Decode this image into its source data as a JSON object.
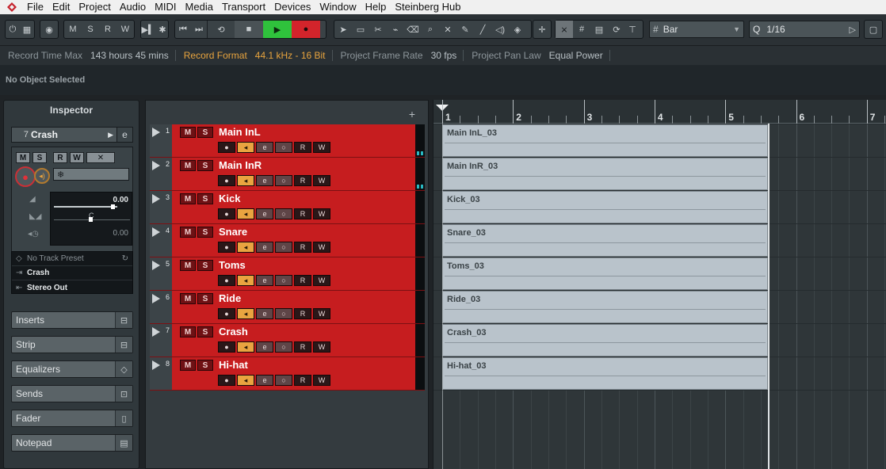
{
  "menu": {
    "logo_icon": "steinberg-logo-icon",
    "items": [
      "File",
      "Edit",
      "Project",
      "Audio",
      "MIDI",
      "Media",
      "Transport",
      "Devices",
      "Window",
      "Help",
      "Steinberg Hub"
    ]
  },
  "toolbar": {
    "state_buttons": [
      "M",
      "S",
      "R",
      "W"
    ],
    "grid_type": "Bar",
    "quantize_value": "1/16",
    "quantize_prefix": "Q"
  },
  "infoline": {
    "record_time_max_label": "Record Time Max",
    "record_time_max_value": "143 hours 45 mins",
    "record_format_label": "Record Format",
    "record_format_value": "44.1 kHz - 16 Bit",
    "frame_rate_label": "Project Frame Rate",
    "frame_rate_value": "30 fps",
    "pan_law_label": "Project Pan Law",
    "pan_law_value": "Equal Power"
  },
  "status": {
    "selection": "No Object Selected"
  },
  "inspector": {
    "title": "Inspector",
    "track_number": "7",
    "track_name": "Crash",
    "buttons": [
      "M",
      "S",
      "R",
      "W"
    ],
    "volume_value": "0.00",
    "pan_value": "C",
    "delay_value": "0.00",
    "preset": "No Track Preset",
    "input": "Crash",
    "output": "Stereo Out",
    "sections": [
      "Inserts",
      "Strip",
      "Equalizers",
      "Sends",
      "Fader",
      "Notepad"
    ]
  },
  "tracks": [
    {
      "num": "1",
      "name": "Main InL",
      "part": "Main InL_03"
    },
    {
      "num": "2",
      "name": "Main InR",
      "part": "Main InR_03"
    },
    {
      "num": "3",
      "name": "Kick",
      "part": "Kick_03"
    },
    {
      "num": "4",
      "name": "Snare",
      "part": "Snare_03"
    },
    {
      "num": "5",
      "name": "Toms",
      "part": "Toms_03"
    },
    {
      "num": "6",
      "name": "Ride",
      "part": "Ride_03"
    },
    {
      "num": "7",
      "name": "Crash",
      "part": "Crash_03"
    },
    {
      "num": "8",
      "name": "Hi-hat",
      "part": "Hi-hat_03"
    }
  ],
  "track_buttons": {
    "mute": "M",
    "solo": "S",
    "read": "R",
    "write": "W",
    "edit": "e"
  },
  "ruler": {
    "bars": [
      "1",
      "2",
      "3",
      "4",
      "5",
      "6",
      "7"
    ]
  },
  "colors": {
    "track_red": "#c61d1f",
    "part_gray": "#b9c3cb",
    "play_green": "#2fc23c",
    "record_red": "#d3242b",
    "highlight_orange": "#e8a43e"
  }
}
